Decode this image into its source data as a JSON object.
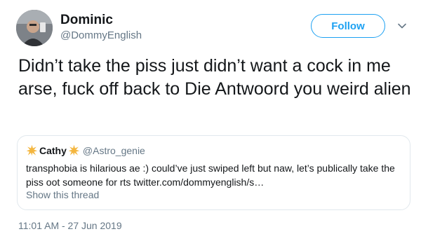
{
  "tweet": {
    "author_name": "Dominic",
    "author_handle": "@DommyEnglish",
    "follow_label": "Follow",
    "text": "Didn’t take the piss just didn’t want a cock in me arse, fuck off back to Die Antwoord you weird alien",
    "timestamp": "11:01 AM - 27 Jun 2019"
  },
  "quoted_tweet": {
    "author_name": "Cathy",
    "author_handle": "@Astro_genie",
    "text": "transphobia is hilarious ae :) could’ve just swiped left but naw, let’s publically take the piss oot someone for rts twitter.com/dommyenglish/s…",
    "show_thread_label": "Show this thread"
  },
  "colors": {
    "accent": "#1da1f2",
    "secondary_text": "#657786",
    "star": "#f4b63f"
  },
  "icons": {
    "menu": "chevron-down-icon",
    "name_decoration": "star-icon"
  }
}
